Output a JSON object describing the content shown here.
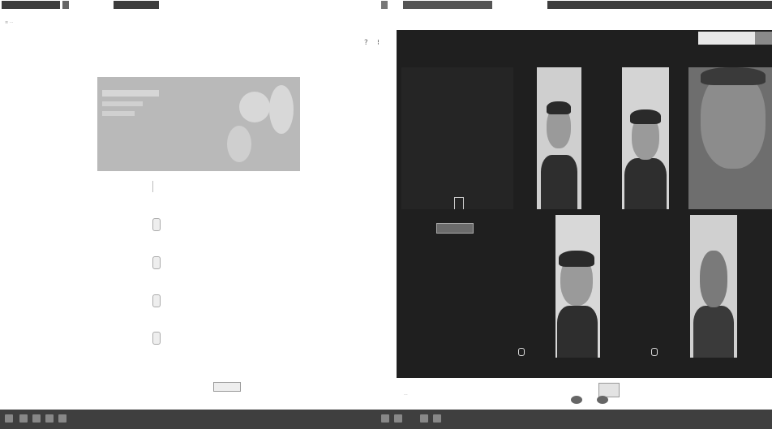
{
  "window": {
    "left_app_title": "",
    "meet_title": ""
  },
  "left_app": {
    "header_text": "",
    "section_text": "",
    "stream_items": [
      {
        "text": ""
      },
      {
        "text": ""
      },
      {
        "text": ""
      },
      {
        "text": ""
      }
    ],
    "footer_label": "",
    "footer_button": ""
  },
  "meet": {
    "presenting_label": "",
    "stop_button": "",
    "participants": [
      {
        "name": ""
      },
      {
        "name": ""
      },
      {
        "name": ""
      },
      {
        "name": ""
      },
      {
        "name": ""
      },
      {
        "name": ""
      }
    ],
    "you_label": ""
  },
  "taskbar": {
    "time": ""
  }
}
